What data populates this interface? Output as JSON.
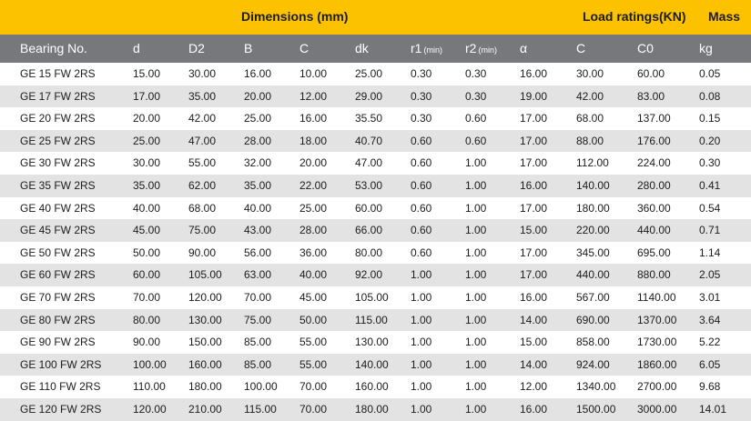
{
  "title_bar": {
    "dimensions": "Dimensions (mm)",
    "load_ratings": "Load ratings(KN)",
    "mass": "Mass"
  },
  "columns": [
    {
      "label": "Bearing No.",
      "sub": ""
    },
    {
      "label": "d",
      "sub": ""
    },
    {
      "label": "D2",
      "sub": ""
    },
    {
      "label": "B",
      "sub": ""
    },
    {
      "label": "C",
      "sub": ""
    },
    {
      "label": "dk",
      "sub": ""
    },
    {
      "label": "r1",
      "sub": "(min)"
    },
    {
      "label": "r2",
      "sub": "(min)"
    },
    {
      "label": "α",
      "sub": ""
    },
    {
      "label": "C",
      "sub": ""
    },
    {
      "label": "C0",
      "sub": ""
    },
    {
      "label": "kg",
      "sub": ""
    }
  ],
  "rows": [
    [
      "GE 15 FW 2RS",
      "15.00",
      "30.00",
      "16.00",
      "10.00",
      "25.00",
      "0.30",
      "0.30",
      "16.00",
      "30.00",
      "60.00",
      "0.05"
    ],
    [
      "GE 17 FW 2RS",
      "17.00",
      "35.00",
      "20.00",
      "12.00",
      "29.00",
      "0.30",
      "0.30",
      "19.00",
      "42.00",
      "83.00",
      "0.08"
    ],
    [
      "GE 20 FW 2RS",
      "20.00",
      "42.00",
      "25.00",
      "16.00",
      "35.50",
      "0.30",
      "0.60",
      "17.00",
      "68.00",
      "137.00",
      "0.15"
    ],
    [
      "GE 25 FW 2RS",
      "25.00",
      "47.00",
      "28.00",
      "18.00",
      "40.70",
      "0.60",
      "0.60",
      "17.00",
      "88.00",
      "176.00",
      "0.20"
    ],
    [
      "GE 30 FW 2RS",
      "30.00",
      "55.00",
      "32.00",
      "20.00",
      "47.00",
      "0.60",
      "1.00",
      "17.00",
      "112.00",
      "224.00",
      "0.30"
    ],
    [
      "GE 35 FW 2RS",
      "35.00",
      "62.00",
      "35.00",
      "22.00",
      "53.00",
      "0.60",
      "1.00",
      "16.00",
      "140.00",
      "280.00",
      "0.41"
    ],
    [
      "GE 40 FW 2RS",
      "40.00",
      "68.00",
      "40.00",
      "25.00",
      "60.00",
      "0.60",
      "1.00",
      "17.00",
      "180.00",
      "360.00",
      "0.54"
    ],
    [
      "GE 45 FW 2RS",
      "45.00",
      "75.00",
      "43.00",
      "28.00",
      "66.00",
      "0.60",
      "1.00",
      "15.00",
      "220.00",
      "440.00",
      "0.71"
    ],
    [
      "GE 50 FW 2RS",
      "50.00",
      "90.00",
      "56.00",
      "36.00",
      "80.00",
      "0.60",
      "1.00",
      "17.00",
      "345.00",
      "695.00",
      "1.14"
    ],
    [
      "GE 60 FW 2RS",
      "60.00",
      "105.00",
      "63.00",
      "40.00",
      "92.00",
      "1.00",
      "1.00",
      "17.00",
      "440.00",
      "880.00",
      "2.05"
    ],
    [
      "GE 70 FW 2RS",
      "70.00",
      "120.00",
      "70.00",
      "45.00",
      "105.00",
      "1.00",
      "1.00",
      "16.00",
      "567.00",
      "1140.00",
      "3.01"
    ],
    [
      "GE 80 FW 2RS",
      "80.00",
      "130.00",
      "75.00",
      "50.00",
      "115.00",
      "1.00",
      "1.00",
      "14.00",
      "690.00",
      "1370.00",
      "3.64"
    ],
    [
      "GE 90 FW 2RS",
      "90.00",
      "150.00",
      "85.00",
      "55.00",
      "130.00",
      "1.00",
      "1.00",
      "15.00",
      "858.00",
      "1730.00",
      "5.22"
    ],
    [
      "GE 100 FW 2RS",
      "100.00",
      "160.00",
      "85.00",
      "55.00",
      "140.00",
      "1.00",
      "1.00",
      "14.00",
      "924.00",
      "1860.00",
      "6.05"
    ],
    [
      "GE 110 FW 2RS",
      "110.00",
      "180.00",
      "100.00",
      "70.00",
      "160.00",
      "1.00",
      "1.00",
      "12.00",
      "1340.00",
      "2700.00",
      "9.68"
    ],
    [
      "GE 120 FW 2RS",
      "120.00",
      "210.00",
      "115.00",
      "70.00",
      "180.00",
      "1.00",
      "1.00",
      "16.00",
      "1500.00",
      "3000.00",
      "14.01"
    ]
  ],
  "colors": {
    "title_bar": "#fcc200",
    "header_bar": "#76787b",
    "alt_row": "#e3e3e4",
    "text": "#1c1c1c"
  }
}
